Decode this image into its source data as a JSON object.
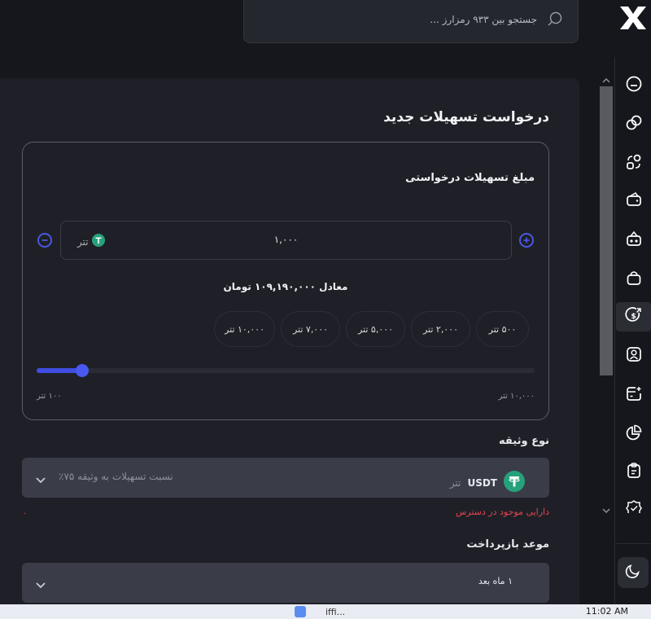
{
  "search": {
    "placeholder": "جستجو بین ۹۳۳ رمزارز ..."
  },
  "page": {
    "title": "درخواست تسهیلات جدید"
  },
  "amount": {
    "label": "مبلغ تسهیلات درخواستی",
    "value": "۱,۰۰۰",
    "unit": "تتر",
    "equivalent": "معادل  ۱۰۹,۱۹۰,۰۰۰ تومان",
    "presets": [
      "۵۰۰ تتر",
      "۲,۰۰۰ تتر",
      "۵,۰۰۰ تتر",
      "۷,۰۰۰ تتر",
      "۱۰,۰۰۰ تتر"
    ],
    "slider": {
      "min_label": "۱۰۰ تتر",
      "max_label": "۱۰,۰۰۰ تتر",
      "min": 100,
      "max": 10000,
      "value": 1000
    }
  },
  "collateral": {
    "title": "نوع وثیقه",
    "coin": "USDT",
    "coin_unit": "تتر",
    "ratio": "نسبت تسهیلات به وثیقه ۷۵٪",
    "error": "دارایی موجود در دسترس",
    "available": "۰"
  },
  "repayment": {
    "title": "موعد بازپرداخت",
    "value": "۱ ماه بعد"
  },
  "sidebar": {
    "icons": [
      "wallet-minus-icon",
      "exchange-icon",
      "convert-icon",
      "wallet-icon",
      "wallet-card-icon",
      "bag-icon",
      "dollar-circle-icon",
      "profile-icon",
      "card-add-icon",
      "pie-chart-icon",
      "clipboard-icon",
      "badge-check-icon"
    ],
    "active_index": 6
  },
  "taskbar": {
    "time": "11:02 AM",
    "text": "iffi..."
  },
  "colors": {
    "accent": "#4a58f2",
    "error": "#e0464e",
    "tether": "#26a17b"
  }
}
